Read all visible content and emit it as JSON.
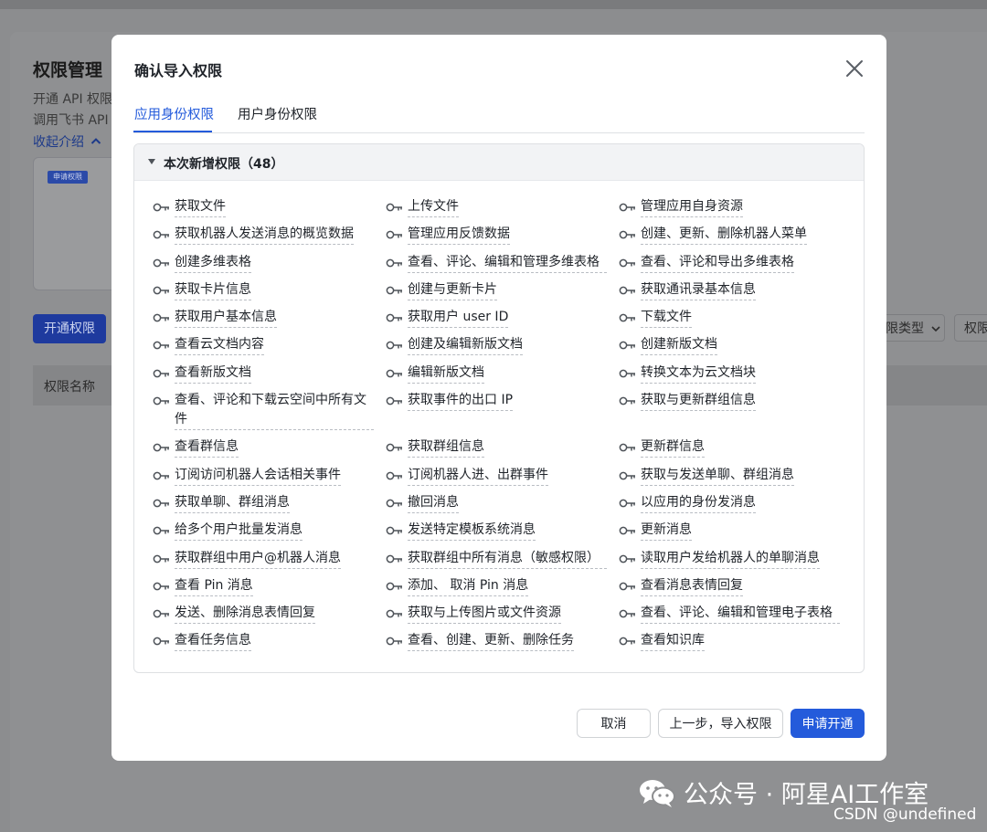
{
  "background": {
    "page_title": "权限管理",
    "intro_line1": "开通 API 权限",
    "intro_line2": "调用飞书 API",
    "collapse_link": "收起介绍",
    "illustration_tag": "申请权限",
    "open_button": "开通权限",
    "filter_type": "权限类型",
    "filter_perm": "权限",
    "table_col_name": "权限名称"
  },
  "modal": {
    "title": "确认导入权限",
    "tabs": [
      {
        "label": "应用身份权限",
        "active": true
      },
      {
        "label": "用户身份权限",
        "active": false
      }
    ],
    "section_title": "本次新增权限（48）",
    "permissions": [
      "获取文件",
      "上传文件",
      "管理应用自身资源",
      "获取机器人发送消息的概览数据",
      "管理应用反馈数据",
      "创建、更新、删除机器人菜单",
      "创建多维表格",
      "查看、评论、编辑和管理多维表格",
      "查看、评论和导出多维表格",
      "获取卡片信息",
      "创建与更新卡片",
      "获取通讯录基本信息",
      "获取用户基本信息",
      "获取用户 user ID",
      "下载文件",
      "查看云文档内容",
      "创建及编辑新版文档",
      "创建新版文档",
      "查看新版文档",
      "编辑新版文档",
      "转换文本为云文档块",
      "查看、评论和下载云空间中所有文件",
      "获取事件的出口 IP",
      "获取与更新群组信息",
      "查看群信息",
      "获取群组信息",
      "更新群信息",
      "订阅访问机器人会话相关事件",
      "订阅机器人进、出群事件",
      "获取与发送单聊、群组消息",
      "获取单聊、群组消息",
      "撤回消息",
      "以应用的身份发消息",
      "给多个用户批量发消息",
      "发送特定模板系统消息",
      "更新消息",
      "获取群组中用户@机器人消息",
      "获取群组中所有消息（敏感权限）",
      "读取用户发给机器人的单聊消息",
      "查看 Pin 消息",
      "添加、 取消 Pin 消息",
      "查看消息表情回复",
      "发送、删除消息表情回复",
      "获取与上传图片或文件资源",
      "查看、评论、编辑和管理电子表格",
      "查看任务信息",
      "查看、创建、更新、删除任务",
      "查看知识库"
    ],
    "buttons": {
      "cancel": "取消",
      "prev": "上一步，导入权限",
      "apply": "申请开通"
    }
  },
  "watermark": {
    "brand": "公众号 · 阿星AI工作室",
    "csdn": "CSDN @undefined"
  },
  "colors": {
    "accent": "#245bdb",
    "overlay": "#8c8d8f"
  }
}
